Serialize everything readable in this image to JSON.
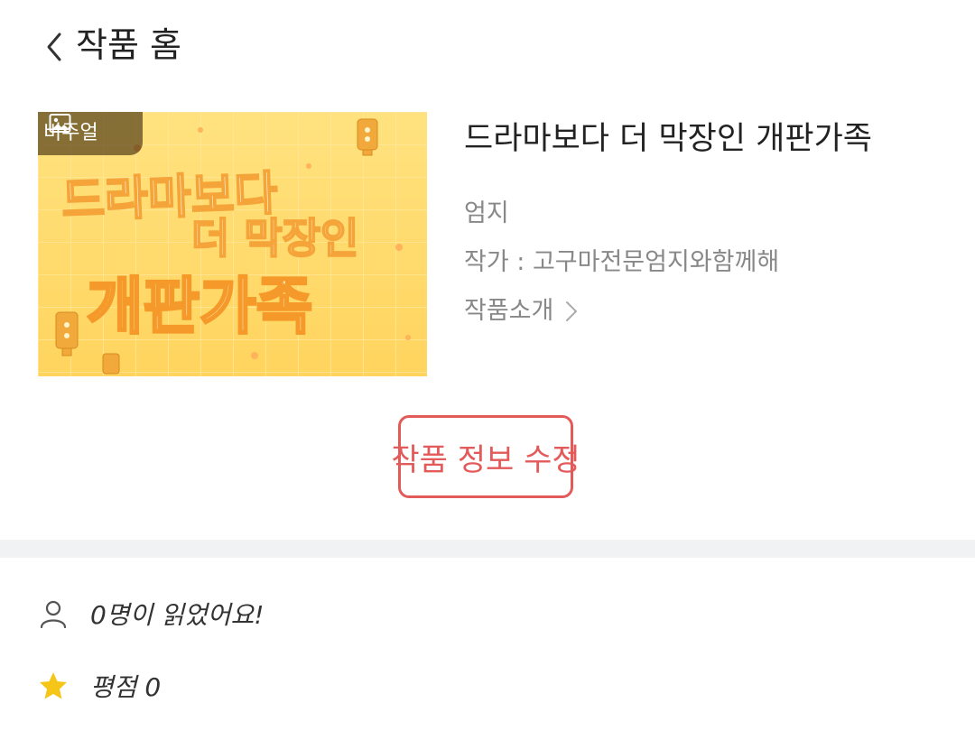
{
  "header": {
    "title": "작품 홈"
  },
  "cover": {
    "badge_label": "비주얼",
    "art_lines": [
      "드라마보다",
      "더 막장인",
      "개판가족"
    ]
  },
  "work": {
    "title": "드라마보다 더 막장인 개판가족",
    "genre": "엄지",
    "author": "작가 : 고구마전문엄지와함께해",
    "intro_label": "작품소개"
  },
  "actions": {
    "edit_label": "작품 정보 수정"
  },
  "stats": {
    "readers": "0명이 읽었어요!",
    "rating": "평점 0"
  },
  "colors": {
    "accent": "#e35a5a",
    "star": "#f5c518",
    "divider": "#f1f2f4"
  }
}
